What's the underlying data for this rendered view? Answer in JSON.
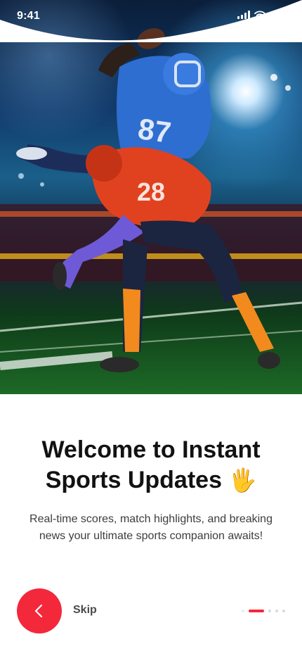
{
  "status_bar": {
    "time": "9:41"
  },
  "onboarding": {
    "title_line1": "Welcome to Instant",
    "title_line2": "Sports Updates",
    "title_emoji": "🖐️",
    "subtitle": "Real-time scores, match highlights, and breaking news your ultimate sports companion awaits!",
    "skip_label": "Skip",
    "page_count": 4,
    "active_page": 1,
    "back_icon": "chevron-left-icon"
  },
  "colors": {
    "accent": "#f4283b",
    "title": "#121212",
    "body": "#3d3d3d"
  }
}
